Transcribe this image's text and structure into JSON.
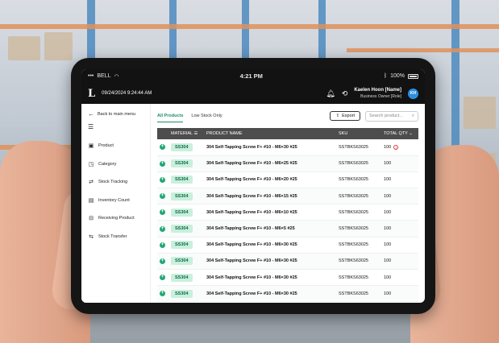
{
  "status_bar": {
    "carrier": "BELL",
    "time": "4:21 PM",
    "battery": "100%"
  },
  "header": {
    "logo": "L",
    "datetime": "09/24/2024 9:24:44 AM",
    "user_name": "Kaelen Hoon [Name]",
    "user_role": "Business Owner [Role]",
    "avatar_initials": "KH"
  },
  "sidebar": {
    "back_label": "Back to main menu",
    "items": [
      {
        "label": "Product",
        "icon": "box-icon"
      },
      {
        "label": "Category",
        "icon": "category-icon"
      },
      {
        "label": "Stock Tracking",
        "icon": "tracking-icon"
      },
      {
        "label": "Inventory Count",
        "icon": "clipboard-icon"
      },
      {
        "label": "Receiving Product",
        "icon": "truck-icon"
      },
      {
        "label": "Stock Transfer",
        "icon": "transfer-icon"
      }
    ]
  },
  "toolbar": {
    "tabs": [
      {
        "label": "All Products",
        "active": true
      },
      {
        "label": "Low Stock Only",
        "active": false
      }
    ],
    "export_label": "Export",
    "search_placeholder": "Search product..."
  },
  "table": {
    "columns": [
      "MATERIAL",
      "PRODUCT NAME",
      "SKU",
      "TOTAL QTY"
    ],
    "rows": [
      {
        "material": "SS304",
        "name": "304 Self-Tapping Screw F+ #10 - M6×30 #25",
        "sku": "SSTBKS63025",
        "qty": "100",
        "warning": true
      },
      {
        "material": "SS304",
        "name": "304 Self-Tapping Screw F+ #10 - M6×25 #25",
        "sku": "SSTBKS63025",
        "qty": "100",
        "warning": false
      },
      {
        "material": "SS304",
        "name": "304 Self-Tapping Screw F+ #10 - M6×20 #25",
        "sku": "SSTBKS63025",
        "qty": "100",
        "warning": false
      },
      {
        "material": "SS304",
        "name": "304 Self-Tapping Screw F+ #10 - M6×15 #25",
        "sku": "SSTBKS63025",
        "qty": "100",
        "warning": false
      },
      {
        "material": "SS304",
        "name": "304 Self-Tapping Screw F+ #10 - M6×10 #25",
        "sku": "SSTBKS63025",
        "qty": "100",
        "warning": false
      },
      {
        "material": "SS304",
        "name": "304 Self-Tapping Screw F+ #10 - M6×5 #25",
        "sku": "SSTBKS63025",
        "qty": "100",
        "warning": false
      },
      {
        "material": "SS304",
        "name": "304 Self-Tapping Screw F+ #10 - M6×30 #25",
        "sku": "SSTBKS63025",
        "qty": "100",
        "warning": false
      },
      {
        "material": "SS304",
        "name": "304 Self-Tapping Screw F+ #10 - M6×30 #25",
        "sku": "SSTBKS63025",
        "qty": "100",
        "warning": false
      },
      {
        "material": "SS304",
        "name": "304 Self-Tapping Screw F+ #10 - M6×30 #25",
        "sku": "SSTBKS63025",
        "qty": "100",
        "warning": false
      },
      {
        "material": "SS304",
        "name": "304 Self-Tapping Screw F+ #10 - M6×30 #25",
        "sku": "SSTBKS63025",
        "qty": "100",
        "warning": false
      }
    ]
  },
  "colors": {
    "accent": "#1a8f63",
    "chip_bg": "#c9f0dd",
    "header_bg": "#121212",
    "table_header_bg": "#4d4d4d",
    "warning": "#e03838"
  }
}
